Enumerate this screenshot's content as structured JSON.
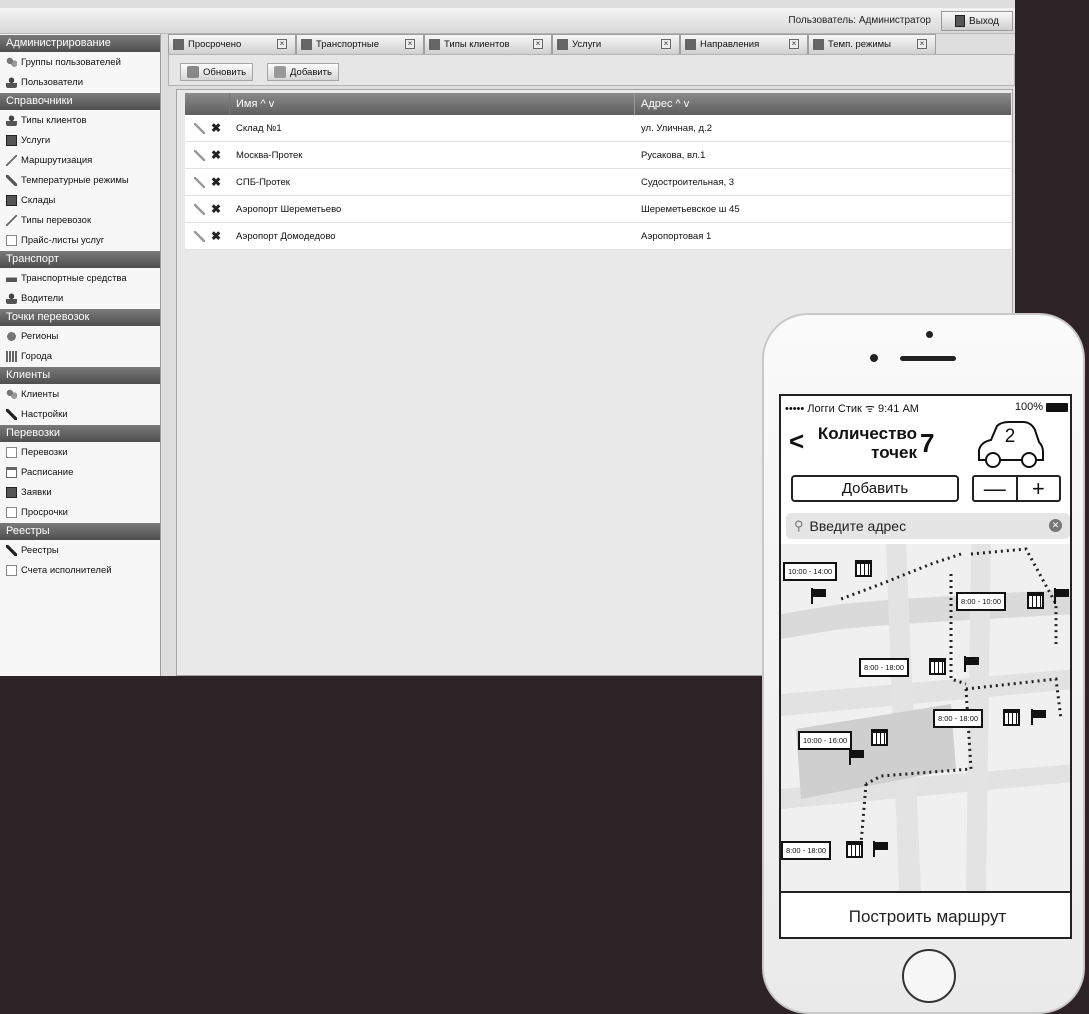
{
  "topbar": {
    "user_text": "Пользователь: Администратор",
    "logout_label": "Выход"
  },
  "sidebar": {
    "sections": [
      {
        "title": "Администрирование",
        "items": [
          {
            "label": "Группы пользователей",
            "icon": "people-icon"
          },
          {
            "label": "Пользователи",
            "icon": "person-icon"
          }
        ]
      },
      {
        "title": "Справочники",
        "items": [
          {
            "label": "Типы клиентов",
            "icon": "person-icon"
          },
          {
            "label": "Услуги",
            "icon": "box-icon"
          },
          {
            "label": "Маршрутизация",
            "icon": "route-icon"
          },
          {
            "label": "Температурные режимы",
            "icon": "thermometer-icon"
          },
          {
            "label": "Склады",
            "icon": "warehouse-icon"
          },
          {
            "label": "Типы перевозок",
            "icon": "route-icon"
          },
          {
            "label": "Прайс-листы услуг",
            "icon": "document-icon"
          }
        ]
      },
      {
        "title": "Транспорт",
        "items": [
          {
            "label": "Транспортные средства",
            "icon": "car-icon"
          },
          {
            "label": "Водители",
            "icon": "person-icon"
          }
        ]
      },
      {
        "title": "Точки перевозок",
        "items": [
          {
            "label": "Регионы",
            "icon": "globe-icon"
          },
          {
            "label": "Города",
            "icon": "city-icon"
          }
        ]
      },
      {
        "title": "Клиенты",
        "items": [
          {
            "label": "Клиенты",
            "icon": "people-icon"
          },
          {
            "label": "Настройки",
            "icon": "pen-icon"
          }
        ]
      },
      {
        "title": "Перевозки",
        "items": [
          {
            "label": "Перевозки",
            "icon": "document-icon"
          },
          {
            "label": "Расписание",
            "icon": "calendar-icon"
          },
          {
            "label": "Заявки",
            "icon": "box-icon"
          },
          {
            "label": "Просрочки",
            "icon": "document-icon"
          }
        ]
      },
      {
        "title": "Реестры",
        "items": [
          {
            "label": "Реестры",
            "icon": "registry-icon"
          },
          {
            "label": "Счета исполнителей",
            "icon": "document-icon"
          }
        ]
      }
    ]
  },
  "tabs": [
    {
      "label": "Просрочено",
      "icon": "document-icon"
    },
    {
      "label": "Транспортные",
      "icon": "car-icon"
    },
    {
      "label": "Типы клиентов",
      "icon": "person-icon"
    },
    {
      "label": "Услуги",
      "icon": "box-icon"
    },
    {
      "label": "Направления",
      "icon": "route-icon"
    },
    {
      "label": "Темп. режимы",
      "icon": "thermometer-icon"
    }
  ],
  "toolbar": {
    "refresh_label": "Обновить",
    "add_label": "Добавить"
  },
  "grid": {
    "columns": [
      "Имя ^ v",
      "Адрес ^ v"
    ],
    "rows": [
      {
        "name": "Склад №1",
        "address": "ул. Уличная, д.2"
      },
      {
        "name": "Москва-Протек",
        "address": "Русакова, вл.1"
      },
      {
        "name": "СПБ-Протек",
        "address": "Судостроительная, 3"
      },
      {
        "name": "Аэропорт Шереметьево",
        "address": "Шереметьевское ш 45"
      },
      {
        "name": "Аэропорт Домодедово",
        "address": "Аэропортовая 1"
      }
    ]
  },
  "phone": {
    "carrier": "••••• Логги Стик",
    "time": "9:41 AM",
    "battery": "100%",
    "count_title_line1": "Количество",
    "count_title_line2": "точек",
    "count_value": "7",
    "car_count": "2",
    "add_label": "Добавить",
    "minus": "—",
    "plus": "+",
    "search_placeholder": "Введите адрес",
    "route_button": "Построить маршрут",
    "map_labels": [
      "10:00 - 14:00",
      "8:00 - 10:00",
      "8:00 - 18:00",
      "8:00 - 18:00",
      "10:00 - 16:00",
      "8:00 - 18:00"
    ]
  }
}
